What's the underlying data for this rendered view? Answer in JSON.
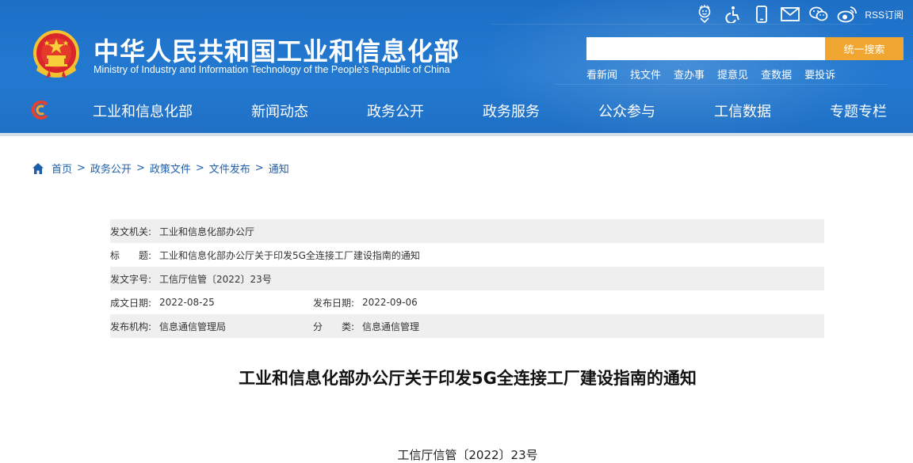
{
  "header": {
    "title": "中华人民共和国工业和信息化部",
    "subtitle": "Ministry of Industry and Information Technology of the People's Republic of China",
    "rss_label": "RSS订阅",
    "search": {
      "placeholder": "",
      "button_label": "统一搜索"
    },
    "quick_links": [
      "看新闻",
      "找文件",
      "查办事",
      "提意见",
      "查数据",
      "要投诉"
    ]
  },
  "nav": {
    "items": [
      "工业和信息化部",
      "新闻动态",
      "政务公开",
      "政务服务",
      "公众参与",
      "工信数据",
      "专题专栏"
    ]
  },
  "breadcrumb": [
    "首页",
    "政务公开",
    "政策文件",
    "文件发布",
    "通知"
  ],
  "meta": {
    "issuer_label": "发文机关:",
    "issuer": "工业和信息化部办公厅",
    "title_label": "标　　题:",
    "title": "工业和信息化部办公厅关于印发5G全连接工厂建设指南的通知",
    "docno_label": "发文字号:",
    "docno": "工信厅信管〔2022〕23号",
    "created_label": "成文日期:",
    "created": "2022-08-25",
    "published_label": "发布日期:",
    "published": "2022-09-06",
    "org_label": "发布机构:",
    "org": "信息通信管理局",
    "category_label": "分　　类:",
    "category": "信息通信管理"
  },
  "article": {
    "title": "工业和信息化部办公厅关于印发5G全连接工厂建设指南的通知",
    "doc_number": "工信厅信管〔2022〕23号"
  },
  "colors": {
    "header_blue": "#1f73c8",
    "search_button": "#f0a631",
    "link_blue": "#1e5ea8",
    "meta_shade": "#efefef"
  }
}
